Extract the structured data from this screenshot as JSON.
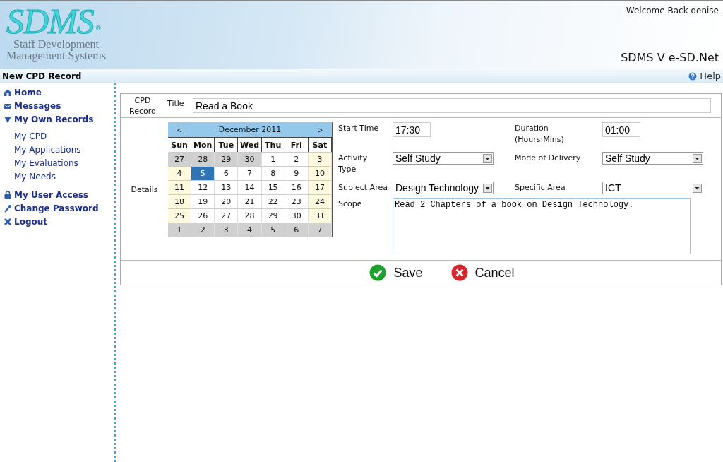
{
  "header": {
    "logo_text": "SDMS",
    "logo_mark": "®",
    "logo_subtitle_1": "Staff Development",
    "logo_subtitle_2": "Management Systems",
    "welcome": "Welcome Back denise",
    "product": "SDMS V e-SD.Net"
  },
  "page_bar": {
    "title": "New CPD Record",
    "help": "Help"
  },
  "sidebar": {
    "items": [
      {
        "label": "Home"
      },
      {
        "label": "Messages"
      },
      {
        "label": "My Own Records",
        "expanded": true,
        "children": [
          {
            "label": "My CPD"
          },
          {
            "label": "My Applications"
          },
          {
            "label": "My Evaluations"
          },
          {
            "label": "My Needs"
          }
        ]
      },
      {
        "label": "My User Access"
      },
      {
        "label": "Change Password"
      },
      {
        "label": "Logout"
      }
    ]
  },
  "form": {
    "section_1": "CPD Record",
    "title_label": "Title",
    "title_value": "Read a Book",
    "section_2": "Details",
    "calendar": {
      "prev": "<",
      "next": ">",
      "month": "December 2011",
      "weekdays": [
        "Sun",
        "Mon",
        "Tue",
        "Wed",
        "Thu",
        "Fri",
        "Sat"
      ],
      "days": [
        {
          "label": "27",
          "kind": "other",
          "selected": false
        },
        {
          "label": "28",
          "kind": "other",
          "selected": false
        },
        {
          "label": "29",
          "kind": "other",
          "selected": false
        },
        {
          "label": "30",
          "kind": "other",
          "selected": false
        },
        {
          "label": "1",
          "kind": "weekday",
          "selected": false
        },
        {
          "label": "2",
          "kind": "weekday",
          "selected": false
        },
        {
          "label": "3",
          "kind": "weekend",
          "selected": false
        },
        {
          "label": "4",
          "kind": "weekend",
          "selected": false
        },
        {
          "label": "5",
          "kind": "weekday",
          "selected": true
        },
        {
          "label": "6",
          "kind": "weekday",
          "selected": false
        },
        {
          "label": "7",
          "kind": "weekday",
          "selected": false
        },
        {
          "label": "8",
          "kind": "weekday",
          "selected": false
        },
        {
          "label": "9",
          "kind": "weekday",
          "selected": false
        },
        {
          "label": "10",
          "kind": "weekend",
          "selected": false
        },
        {
          "label": "11",
          "kind": "weekend",
          "selected": false
        },
        {
          "label": "12",
          "kind": "weekday",
          "selected": false
        },
        {
          "label": "13",
          "kind": "weekday",
          "selected": false
        },
        {
          "label": "14",
          "kind": "weekday",
          "selected": false
        },
        {
          "label": "15",
          "kind": "weekday",
          "selected": false
        },
        {
          "label": "16",
          "kind": "weekday",
          "selected": false
        },
        {
          "label": "17",
          "kind": "weekend",
          "selected": false
        },
        {
          "label": "18",
          "kind": "weekend",
          "selected": false
        },
        {
          "label": "19",
          "kind": "weekday",
          "selected": false
        },
        {
          "label": "20",
          "kind": "weekday",
          "selected": false
        },
        {
          "label": "21",
          "kind": "weekday",
          "selected": false
        },
        {
          "label": "22",
          "kind": "weekday",
          "selected": false
        },
        {
          "label": "23",
          "kind": "weekday",
          "selected": false
        },
        {
          "label": "24",
          "kind": "weekend",
          "selected": false
        },
        {
          "label": "25",
          "kind": "weekend",
          "selected": false
        },
        {
          "label": "26",
          "kind": "weekday",
          "selected": false
        },
        {
          "label": "27",
          "kind": "weekday",
          "selected": false
        },
        {
          "label": "28",
          "kind": "weekday",
          "selected": false
        },
        {
          "label": "29",
          "kind": "weekday",
          "selected": false
        },
        {
          "label": "30",
          "kind": "weekday",
          "selected": false
        },
        {
          "label": "31",
          "kind": "weekend",
          "selected": false
        },
        {
          "label": "1",
          "kind": "other",
          "selected": false
        },
        {
          "label": "2",
          "kind": "other",
          "selected": false
        },
        {
          "label": "3",
          "kind": "other",
          "selected": false
        },
        {
          "label": "4",
          "kind": "other",
          "selected": false
        },
        {
          "label": "5",
          "kind": "other",
          "selected": false
        },
        {
          "label": "6",
          "kind": "other",
          "selected": false
        },
        {
          "label": "7",
          "kind": "other",
          "selected": false
        }
      ]
    },
    "fields": [
      {
        "label": "Start Time",
        "kind": "text",
        "value": "17:30"
      },
      {
        "label": "Duration (Hours:Mins)",
        "kind": "text",
        "value": "01:00"
      },
      {
        "label": "Activity Type",
        "kind": "select",
        "value": "Self Study"
      },
      {
        "label": "Mode of Delivery",
        "kind": "select",
        "value": "Self Study"
      },
      {
        "label": "Subject Area",
        "kind": "select",
        "value": "Design Technology"
      },
      {
        "label": "Specific Area",
        "kind": "select",
        "value": "ICT"
      }
    ],
    "scope_label": "Scope",
    "scope_value": "Read 2 Chapters of a book on Design Technology.",
    "buttons": [
      {
        "label": "Save",
        "kind": "save"
      },
      {
        "label": "Cancel",
        "kind": "cancel"
      }
    ]
  }
}
